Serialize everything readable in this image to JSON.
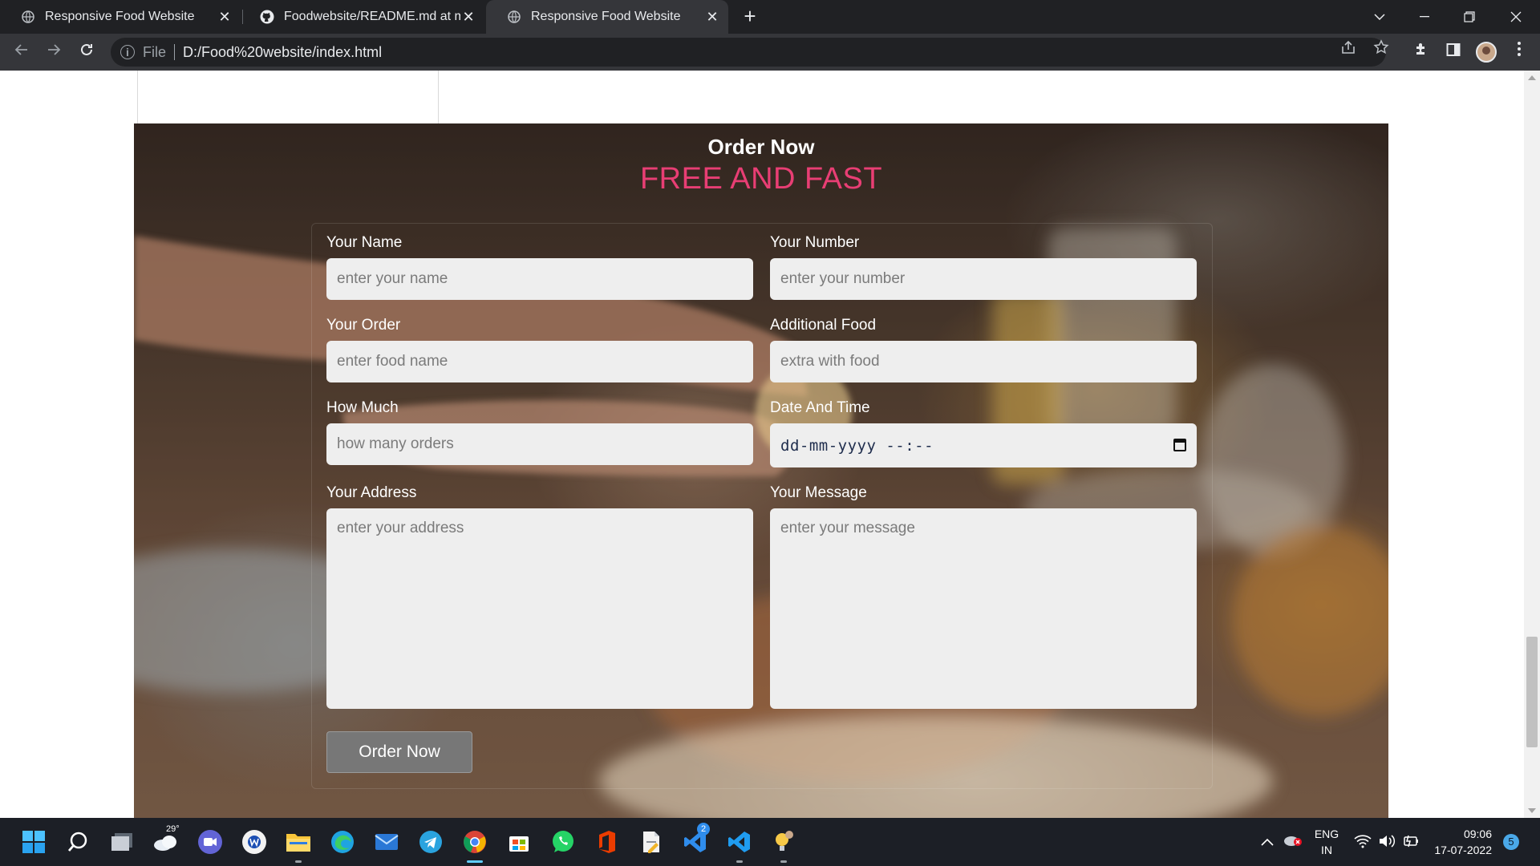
{
  "browser": {
    "tabs": [
      {
        "title": "Responsive Food Website",
        "icon": "globe-icon",
        "active": false
      },
      {
        "title": "Foodwebsite/README.md at mai",
        "icon": "github-icon",
        "active": false
      },
      {
        "title": "Responsive Food Website",
        "icon": "globe-icon",
        "active": true
      }
    ],
    "close_glyph": "✕",
    "new_tab_glyph": "+",
    "address": {
      "scheme": "File",
      "url": "D:/Food%20website/index.html"
    }
  },
  "page": {
    "heading": "Order Now",
    "subheading": "FREE AND FAST",
    "subheading_color": "#e83e74",
    "form": {
      "name": {
        "label": "Your Name",
        "placeholder": "enter your name"
      },
      "number": {
        "label": "Your Number",
        "placeholder": "enter your number"
      },
      "order": {
        "label": "Your Order",
        "placeholder": "enter food name"
      },
      "additional": {
        "label": "Additional Food",
        "placeholder": "extra with food"
      },
      "how_much": {
        "label": "How Much",
        "placeholder": "how many orders"
      },
      "datetime": {
        "label": "Date And Time",
        "placeholder": "dd-mm-yyyy --:--"
      },
      "address": {
        "label": "Your Address",
        "placeholder": "enter your address"
      },
      "message": {
        "label": "Your Message",
        "placeholder": "enter your message"
      },
      "submit_label": "Order Now"
    }
  },
  "taskbar": {
    "weather_temp": "29°",
    "apps": [
      "windows-start",
      "search",
      "task-view",
      "weather",
      "teams-chat",
      "word-like",
      "file-explorer",
      "edge",
      "mail",
      "telegram",
      "chrome",
      "microsoft-store",
      "whatsapp",
      "office",
      "file-editor",
      "vscode-blue",
      "vscode",
      "idea-bulb"
    ],
    "chrome_badge": "",
    "store_badge": "2",
    "language": "ENG",
    "region": "IN",
    "time": "09:06",
    "date": "17-07-2022",
    "notifications": "5"
  }
}
